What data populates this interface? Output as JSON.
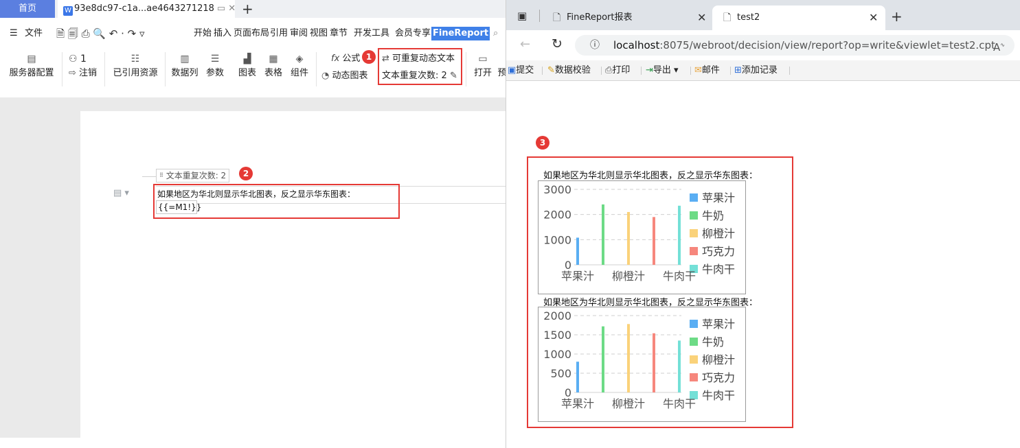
{
  "wps": {
    "home_tab": "首页",
    "doc_tab": "93e8dc97-c1a...ae4643271218",
    "doc_icon": "W",
    "menu": {
      "file": "文件",
      "items": [
        "开始",
        "插入",
        "页面布局",
        "引用",
        "审阅",
        "视图",
        "章节",
        "开发工具",
        "会员专享"
      ],
      "brand": "FineReport"
    },
    "ribbon": {
      "server_config": "服务器配置",
      "user_count": "1",
      "logout": "注销",
      "referenced": "已引用资源",
      "data_column": "数据列",
      "param": "参数",
      "chart": "图表",
      "table": "表格",
      "component": "组件",
      "formula": "公式",
      "dynamic_chart": "动态图表",
      "repeatable_text": "可重复动态文本",
      "repeat_count": "文本重复次数: 2",
      "open": "打开",
      "preview_partial": "预"
    },
    "doc": {
      "repeat_label": "文本重复次数: 2",
      "text_line": "如果地区为华北则显示华北图表，反之显示华东图表：",
      "formula": "{{=M1!}}"
    },
    "badges": [
      "1",
      "2"
    ]
  },
  "browser": {
    "tabs": [
      "FineReport报表",
      "test2"
    ],
    "url_host": "localhost",
    "url_rest": ":8075/webroot/decision/view/report?op=write&viewlet=test2.cpt",
    "toolbar": [
      "提交",
      "数据校验",
      "打印",
      "导出",
      "邮件",
      "添加记录"
    ],
    "badge": "3"
  },
  "colors": {
    "series": [
      "#5aaef3",
      "#6ddb86",
      "#fad27a",
      "#f6877d",
      "#74e0d7"
    ],
    "highlight": "#e53935",
    "brand": "#3f80e8"
  },
  "chart_data": [
    {
      "type": "bar",
      "title": "如果地区为华北则显示华北图表，反之显示华东图表：",
      "categories": [
        "苹果汁",
        "柳橙汁",
        "牛肉干"
      ],
      "series": [
        {
          "name": "苹果汁",
          "values": [
            1080
          ]
        },
        {
          "name": "牛奶",
          "values": [
            2400
          ]
        },
        {
          "name": "柳橙汁",
          "values": [
            2100
          ]
        },
        {
          "name": "巧克力",
          "values": [
            1900
          ]
        },
        {
          "name": "牛肉干",
          "values": [
            2350
          ]
        }
      ],
      "yticks": [
        "3000",
        "2000",
        "1000",
        "0"
      ],
      "ylim": [
        0,
        3000
      ],
      "legend": "right",
      "grid": true
    },
    {
      "type": "bar",
      "title": "如果地区为华北则显示华北图表，反之显示华东图表：",
      "categories": [
        "苹果汁",
        "柳橙汁",
        "牛肉干"
      ],
      "series": [
        {
          "name": "苹果汁",
          "values": [
            800
          ]
        },
        {
          "name": "牛奶",
          "values": [
            1720
          ]
        },
        {
          "name": "柳橙汁",
          "values": [
            1780
          ]
        },
        {
          "name": "巧克力",
          "values": [
            1540
          ]
        },
        {
          "name": "牛肉干",
          "values": [
            1350
          ]
        }
      ],
      "yticks": [
        "2000",
        "1500",
        "1000",
        "500",
        "0"
      ],
      "ylim": [
        0,
        2000
      ],
      "legend": "right",
      "grid": true
    }
  ]
}
